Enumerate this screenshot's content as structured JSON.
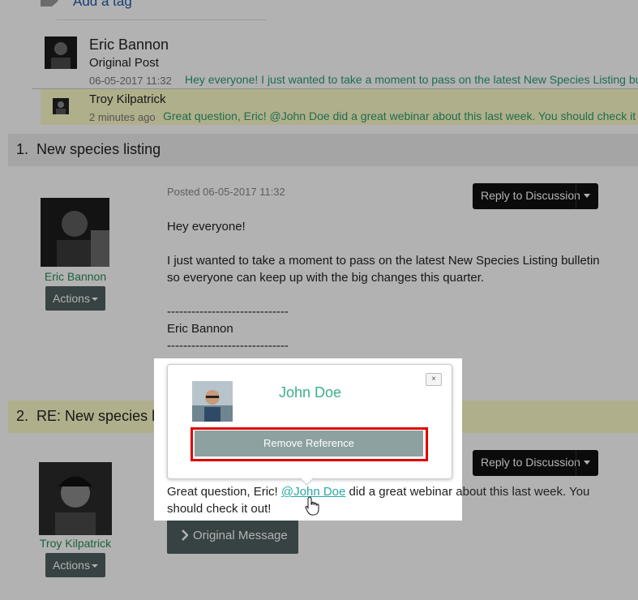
{
  "tags": {
    "add_tag_label": "Add a tag"
  },
  "thread": [
    {
      "author": "Eric Bannon",
      "type": "Original Post",
      "date": "06-05-2017 11:32",
      "snippet": "Hey everyone! I just wanted to take a moment to pass on the latest New Species Listing bulletin"
    },
    {
      "author": "Troy Kilpatrick",
      "time": "2 minutes ago",
      "snippet": "Great question, Eric! @John Doe did a great webinar about this last week. You should check it out!"
    }
  ],
  "posts": [
    {
      "number": "1.",
      "title": "New species listing",
      "author": "Eric Bannon",
      "actions_label": "Actions",
      "posted": "Posted 06-05-2017 11:32",
      "reply_label": "Reply to Discussion",
      "lines": [
        "Hey everyone!",
        "I just wanted to take a moment to pass on the latest New Species Listing bulletin",
        "so everyone can keep up with the big changes this quarter.",
        "------------------------------",
        "Eric Bannon",
        "------------------------------"
      ]
    },
    {
      "number": "2.",
      "title": "RE: New species listing",
      "author": "Troy Kilpatrick",
      "actions_label": "Actions",
      "reply_label": "Reply to Discussion",
      "text_before": "Great question, Eric! ",
      "mention": "@John Doe",
      "text_after": " did a great webinar about this last week. You",
      "text_line2": "should check it out!",
      "original_message_label": "Original Message"
    }
  ],
  "popover": {
    "name": "John Doe",
    "close_label": "×",
    "remove_label": "Remove Reference"
  },
  "colors": {
    "accent_green": "#2a9d6f",
    "highlight_yellow": "#fdfbc8",
    "button_dark": "#4f5f5f",
    "remove_button": "#8ca1a0",
    "outline_red": "#e00000"
  }
}
